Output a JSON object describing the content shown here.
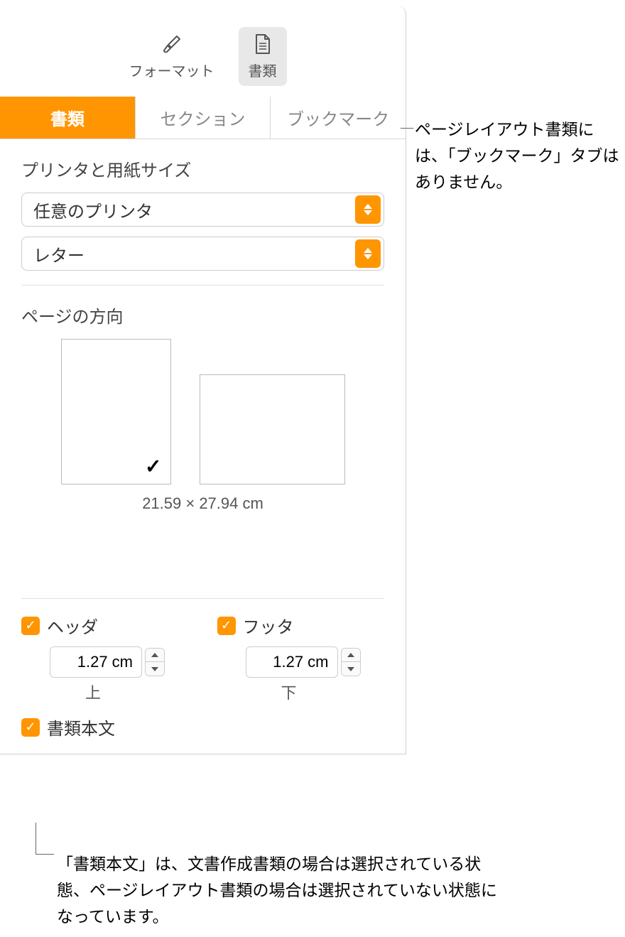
{
  "toolbar": {
    "format_label": "フォーマット",
    "document_label": "書類"
  },
  "tabs": {
    "document": "書類",
    "section": "セクション",
    "bookmark": "ブックマーク"
  },
  "printer_section": {
    "title": "プリンタと用紙サイズ",
    "printer_value": "任意のプリンタ",
    "paper_value": "レター"
  },
  "orientation": {
    "title": "ページの方向",
    "dimensions": "21.59 × 27.94 cm"
  },
  "header": {
    "label": "ヘッダ",
    "value": "1.27 cm",
    "sub": "上"
  },
  "footer": {
    "label": "フッタ",
    "value": "1.27 cm",
    "sub": "下"
  },
  "document_body": {
    "label": "書類本文"
  },
  "callouts": {
    "bookmark_note": "ページレイアウト書類には、「ブックマーク」タブはありません。",
    "body_note": "「書類本文」は、文書作成書類の場合は選択されている状態、ページレイアウト書類の場合は選択されていない状態になっています。"
  }
}
